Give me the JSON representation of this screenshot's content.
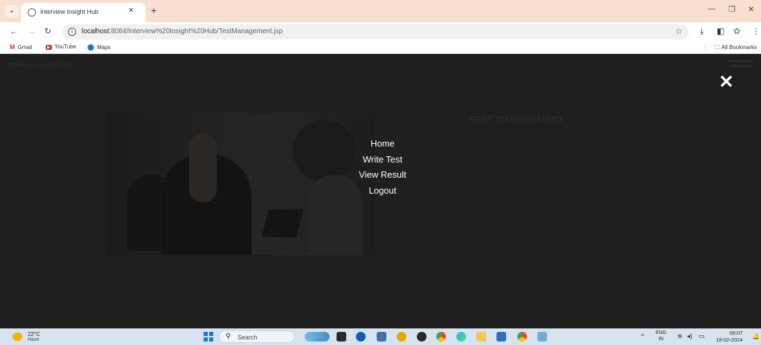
{
  "browser": {
    "tab_title": "Interview Insight Hub",
    "url_host": "localhost",
    "url_path": ":8084/Interview%20Insight%20Hub/TestManagement.jsp",
    "bookmarks": [
      "Gmail",
      "YouTube",
      "Maps"
    ],
    "all_bookmarks": "All Bookmarks"
  },
  "page": {
    "brand": "Interview Insight Hub",
    "section_title": "TEST MANAGEMENT",
    "menu": [
      "Home",
      "Write Test",
      "View Result",
      "Logout"
    ]
  },
  "taskbar": {
    "temperature": "22°C",
    "condition": "Haze",
    "search_label": "Search",
    "lang_top": "ENG",
    "lang_bottom": "IN",
    "time": "09:07",
    "date": "19-02-2024"
  },
  "colors": {
    "overlay": "#1f1f1f",
    "menu_text": "#ffffff",
    "tab_strip": "#f9dfd0"
  }
}
